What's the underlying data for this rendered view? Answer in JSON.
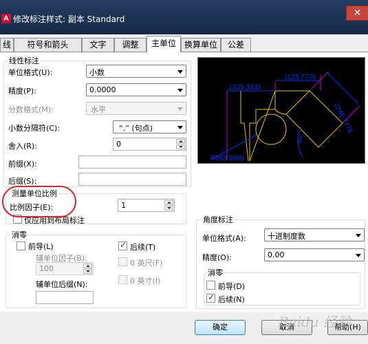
{
  "window": {
    "title": "修改标注样式: 副本 Standard",
    "app_icon": "A",
    "close": "✕"
  },
  "tabs": [
    {
      "label": "线",
      "active": false
    },
    {
      "label": "符号和箭头",
      "active": false
    },
    {
      "label": "文字",
      "active": false
    },
    {
      "label": "调整",
      "active": false
    },
    {
      "label": "主单位",
      "active": true
    },
    {
      "label": "换算单位",
      "active": false
    },
    {
      "label": "公差",
      "active": false
    }
  ],
  "linear": {
    "group_title": "线性标注",
    "unit_format_label": "单位格式(U):",
    "unit_format_value": "小数",
    "precision_label": "精度(P):",
    "precision_value": "0.0000",
    "fraction_label": "分数格式(M):",
    "fraction_value": "水平",
    "decimal_sep_label": "小数分隔符(C):",
    "decimal_sep_value": "“.” (句点)",
    "round_label": "舍入(R):",
    "round_value": "0",
    "prefix_label": "前缀(X):",
    "prefix_value": "",
    "suffix_label": "后缀(S):",
    "suffix_value": ""
  },
  "scale": {
    "group_title": "测量单位比例",
    "factor_label": "比例因子(E):",
    "factor_value": "1",
    "layout_only_label": "仅应用到布局标注",
    "layout_only_checked": false
  },
  "zero_linear": {
    "group_title": "消零",
    "leading_label": "前导(L)",
    "leading_checked": false,
    "trailing_label": "后续(T)",
    "trailing_checked": true,
    "sub_factor_label": "辅单位因子(B):",
    "sub_factor_value": "100",
    "feet_label": "0 英尺(F)",
    "feet_checked": false,
    "sub_suffix_label": "辅单位后缀(N):",
    "sub_suffix_value": "",
    "inches_label": "0 英寸(I)",
    "inches_checked": false
  },
  "angular": {
    "group_title": "角度标注",
    "unit_format_label": "单位格式(A):",
    "unit_format_value": "十进制度数",
    "precision_label": "精度(O):",
    "precision_value": "0.00",
    "zero_title": "消零",
    "leading_label": "前导(D)",
    "leading_checked": false,
    "trailing_label": "后续(N)",
    "trailing_checked": true
  },
  "preview": {
    "dim_top": "1128.7778",
    "dim_left": "1329.3333",
    "dim_diag": "2246.7776",
    "dim_radius": "R593.9999",
    "dim_angle": "60°",
    "colors": {
      "dimension": "#0033ff",
      "geometry": "#e6c400",
      "extension": "#cc00cc",
      "background": "#000000"
    }
  },
  "buttons": {
    "ok": "确定",
    "cancel": "取消",
    "help": "帮助(H)"
  },
  "watermark": "Baidu 经验",
  "colors": {
    "title_bar": "#1c3355",
    "close_button": "#c9453b",
    "annotation_ellipse": "#d9262b"
  }
}
